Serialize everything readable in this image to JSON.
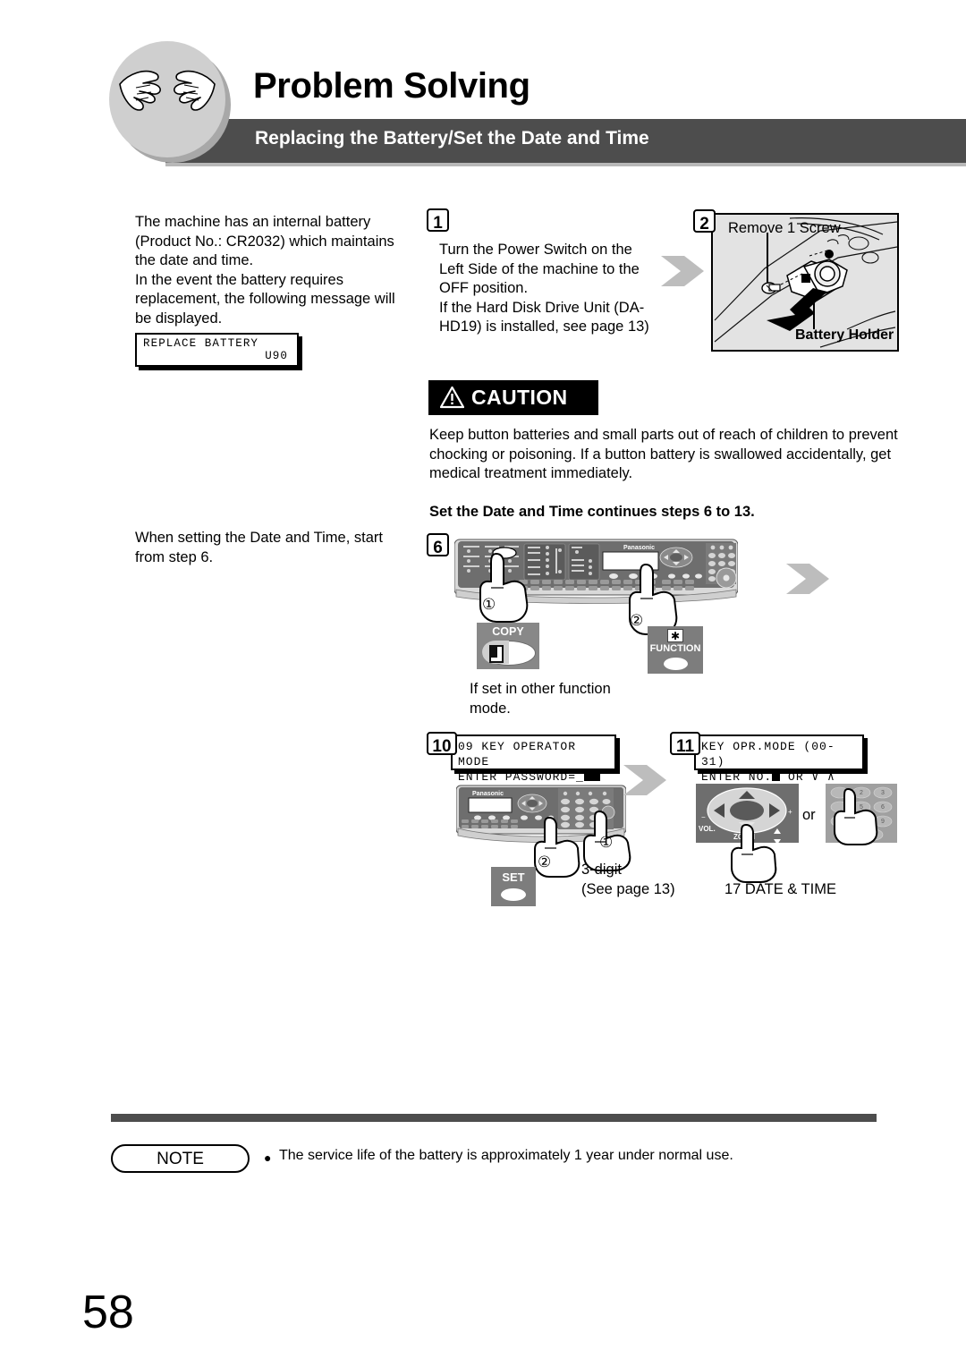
{
  "header": {
    "title": "Problem Solving",
    "subtitle": "Replacing the Battery/Set the Date and Time",
    "icon": "hands-icon"
  },
  "left_column": {
    "intro_paragraph": "The machine has an internal battery (Product No.: CR2032) which maintains the date and time.\nIn the event the battery requires replacement, the following message will be displayed.",
    "lcd_replace_battery": {
      "line1": "REPLACE BATTERY",
      "line2": "U90"
    },
    "when_setting_text": "When setting the Date and Time, start from step 6."
  },
  "steps": {
    "step1": {
      "number": "1",
      "text": "Turn the Power Switch on the Left Side of the machine to the OFF position.\nIf the Hard Disk Drive Unit (DA-HD19) is installed, see page 13)"
    },
    "step2": {
      "number": "2",
      "label_screw": "Remove 1 Screw",
      "label_holder": "Battery Holder",
      "illustration": "battery-holder-diagram"
    },
    "step6": {
      "number": "6",
      "illustration": "control-panel-diagram",
      "marker1": "①",
      "marker2": "②",
      "copy_button_label": "COPY",
      "function_button_label": "FUNCTION",
      "function_button_symbol": "✱",
      "caption": "If set in other function mode."
    },
    "step10": {
      "number": "10",
      "lcd_line1": "09 KEY OPERATOR MODE",
      "lcd_line2_prefix": "ENTER PASSWORD=_",
      "illustration": "control-panel-keypad-diagram",
      "marker1": "①",
      "marker2": "②",
      "set_button_label": "SET",
      "caption": "3-digit\n(See page 13)"
    },
    "step11": {
      "number": "11",
      "lcd_line1": "KEY OPR.MODE (00-31)",
      "lcd_line2_prefix": "ENTER NO.",
      "lcd_line2_suffix": " OR ∨ ∧",
      "arrow_pad_label_vol": "VOL.",
      "arrow_pad_label_zoom": "ZOOM",
      "or_label": "or",
      "caption": "17 DATE & TIME"
    }
  },
  "caution": {
    "badge_label": "CAUTION",
    "icon": "warning-triangle-icon",
    "body": "Keep button batteries and small parts out of reach of children to prevent chocking or poisoning. If a button battery is swallowed accidentally, get medical treatment immediately."
  },
  "set_date_time_heading": "Set the Date and Time continues steps 6 to 13.",
  "footer": {
    "note_label": "NOTE",
    "note_bullet": "●",
    "note_text": "The service life of the battery is approximately 1 year under normal use.",
    "page_number": "58"
  },
  "colors": {
    "band": "#4d4d4d",
    "circle": "#cfcfcf",
    "arrow": "#bdbdbd",
    "panel_dark": "#6e6e6e",
    "panel_mid": "#888888"
  }
}
